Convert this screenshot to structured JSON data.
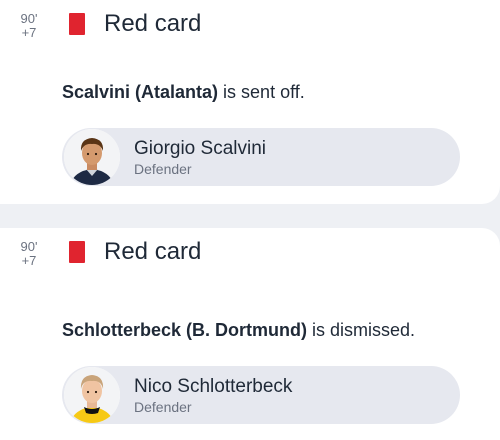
{
  "events": [
    {
      "minute": "90'",
      "added_time": "+7",
      "card_type": "Red card",
      "card_color": "#e0242f",
      "description_bold": "Scalvini (Atalanta)",
      "description_rest": " is sent off.",
      "player": {
        "name": "Giorgio Scalvini",
        "position": "Defender",
        "avatar_icon": "player-photo-icon"
      }
    },
    {
      "minute": "90'",
      "added_time": "+7",
      "card_type": "Red card",
      "card_color": "#e0242f",
      "description_bold": "Schlotterbeck (B. Dortmund)",
      "description_rest": " is dismissed.",
      "player": {
        "name": "Nico Schlotterbeck",
        "position": "Defender",
        "avatar_icon": "player-photo-icon"
      }
    }
  ]
}
